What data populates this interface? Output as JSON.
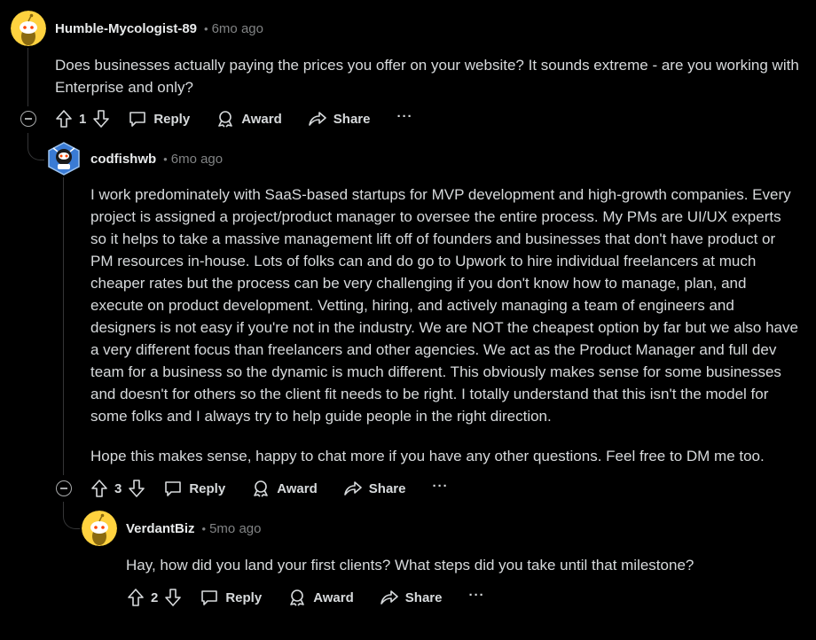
{
  "comments": [
    {
      "username": "Humble-Mycologist-89",
      "separator": "•",
      "time": "6mo ago",
      "avatar_color": "#FFD23F",
      "body": [
        "Does businesses actually paying the prices you offer on your website? It sounds extreme - are you working with Enterprise and only?"
      ],
      "score": "1",
      "actions": {
        "reply": "Reply",
        "award": "Award",
        "share": "Share",
        "more": "···"
      }
    },
    {
      "username": "codfishwb",
      "separator": "•",
      "time": "6mo ago",
      "avatar_color": "#3A7BD5",
      "body": [
        "I work predominately with SaaS-based startups for MVP development and high-growth companies. Every project is assigned a project/product manager to oversee the entire process. My PMs are UI/UX experts so it helps to take a massive management lift off of founders and businesses that don't have product or PM resources in-house. Lots of folks can and do go to Upwork to hire individual freelancers at much cheaper rates but the process can be very challenging if you don't know how to manage, plan, and execute on product development. Vetting, hiring, and actively managing a team of engineers and designers is not easy if you're not in the industry. We are NOT the cheapest option by far but we also have a very different focus than freelancers and other agencies. We act as the Product Manager and full dev team for a business so the dynamic is much different. This obviously makes sense for some businesses and doesn't for others so the client fit needs to be right. I totally understand that this isn't the model for some folks and I always try to help guide people in the right direction.",
        "Hope this makes sense, happy to chat more if you have any other questions. Feel free to DM me too."
      ],
      "score": "3",
      "actions": {
        "reply": "Reply",
        "award": "Award",
        "share": "Share",
        "more": "···"
      }
    },
    {
      "username": "VerdantBiz",
      "separator": "•",
      "time": "5mo ago",
      "avatar_color": "#FFD23F",
      "body": [
        "Hay, how did you land your first clients? What steps did you take until that milestone?"
      ],
      "score": "2",
      "actions": {
        "reply": "Reply",
        "award": "Award",
        "share": "Share",
        "more": "···"
      }
    }
  ]
}
